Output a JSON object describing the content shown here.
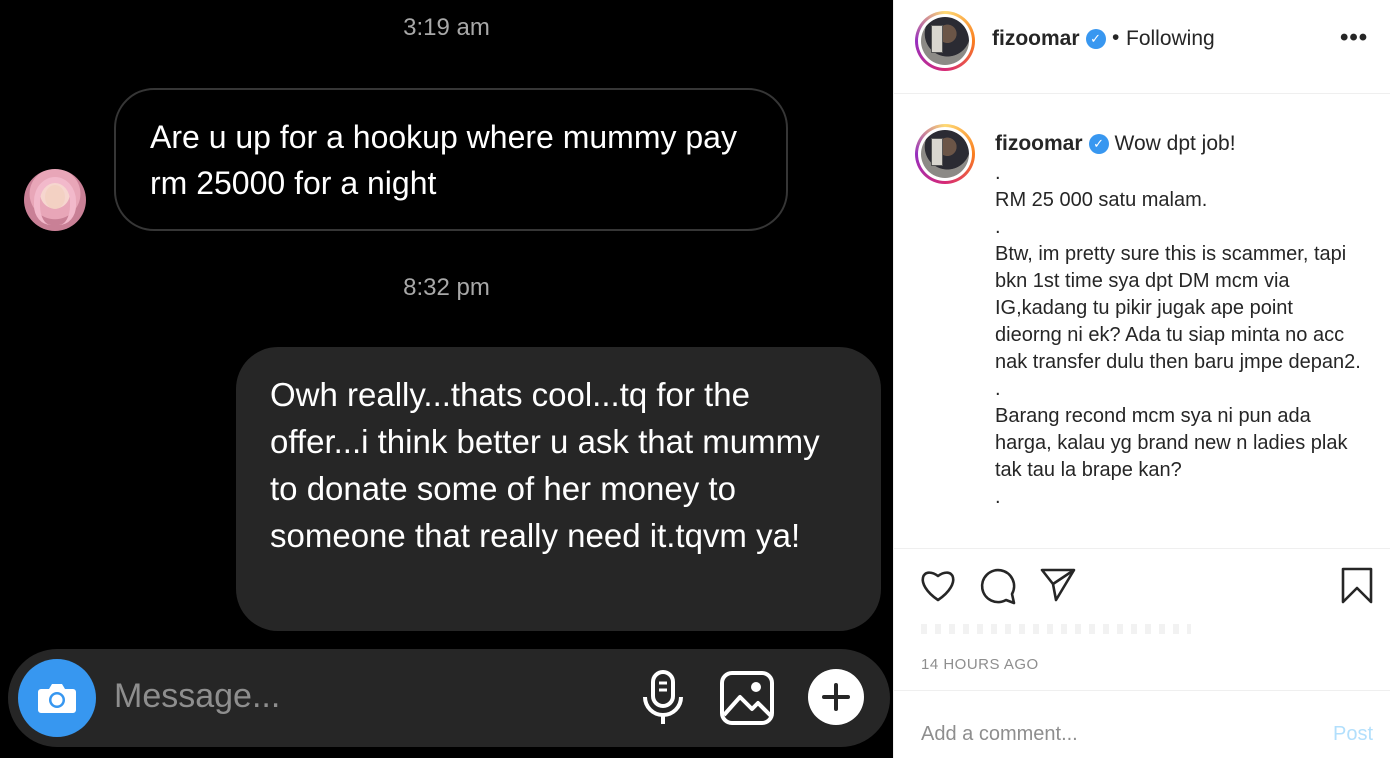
{
  "dm": {
    "timestamp_1": "3:19 am",
    "incoming_message": "Are u up for a hookup where mummy pay rm 25000 for a night",
    "timestamp_2": "8:32 pm",
    "outgoing_message": "Owh really...thats cool...tq for the offer...i think better u ask that mummy to donate some of her money to someone that really need it.tqvm ya!",
    "composer": {
      "placeholder": "Message...",
      "icons": [
        "camera-icon",
        "microphone-icon",
        "gallery-icon",
        "plus-icon"
      ],
      "camera_color": "#3797f0"
    }
  },
  "post": {
    "header": {
      "username": "fizoomar",
      "verified_mark": "✓",
      "separator": "•",
      "follow_status": "Following",
      "more": "•••"
    },
    "caption": {
      "username": "fizoomar",
      "first_line": "Wow dpt job!",
      "body": ".\nRM 25 000 satu malam.\n.\nBtw, im pretty sure this is scammer, tapi bkn 1st time sya dpt DM mcm via IG,kadang tu pikir jugak ape point dieorng ni ek? Ada tu siap minta no acc nak transfer dulu then baru jmpe depan2.\n.\nBarang recond mcm sya ni pun ada harga, kalau yg brand new n ladies plak tak tau la brape kan?\n."
    },
    "actions": [
      "heart-icon",
      "comment-icon",
      "share-icon",
      "bookmark-icon"
    ],
    "time_ago": "14 HOURS AGO",
    "comment": {
      "placeholder": "Add a comment...",
      "post_label": "Post"
    },
    "colors": {
      "verified": "#3897f0",
      "post_disabled": "#b2dffc"
    }
  }
}
